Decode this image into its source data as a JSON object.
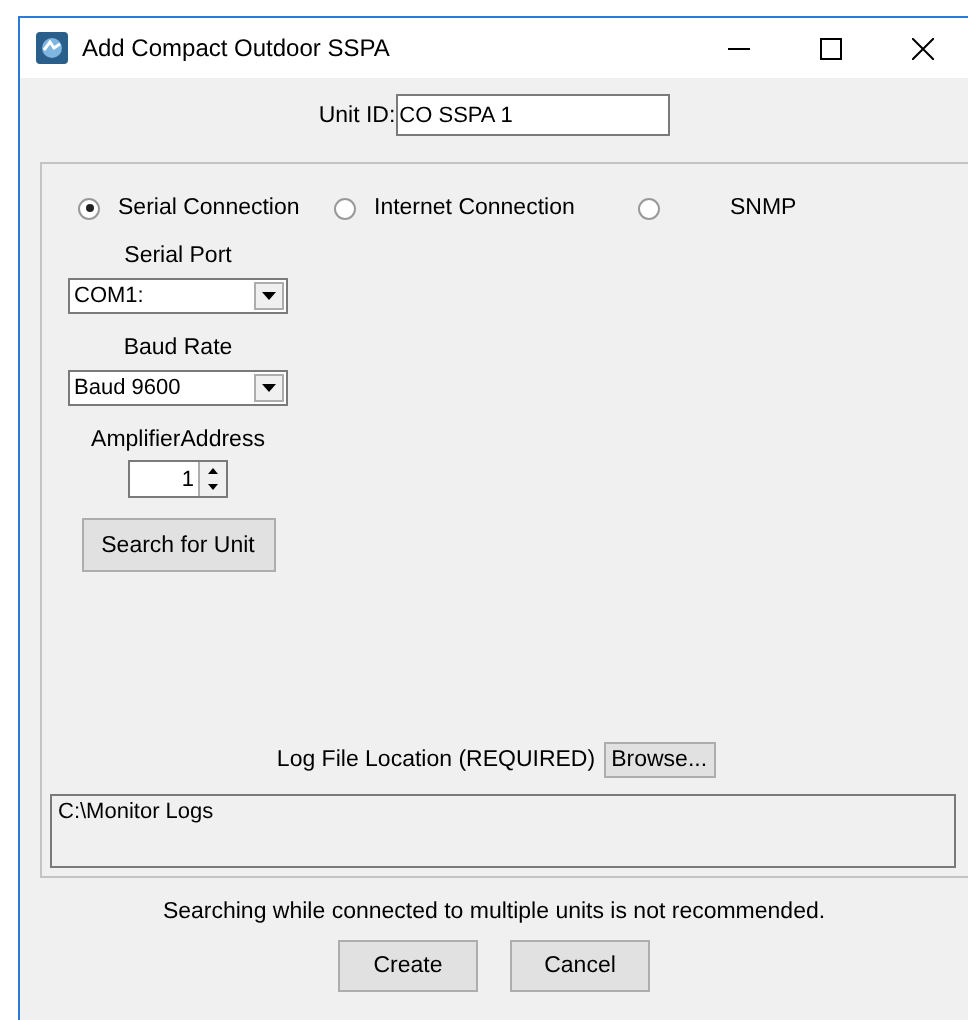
{
  "window": {
    "title": "Add Compact Outdoor SSPA"
  },
  "unit_id": {
    "label": "Unit ID:",
    "value": "CO SSPA 1"
  },
  "connection_options": [
    {
      "label": "Serial Connection",
      "selected": true
    },
    {
      "label": "Internet Connection",
      "selected": false
    },
    {
      "label": "SNMP",
      "selected": false
    }
  ],
  "serial_port": {
    "label": "Serial Port",
    "value": "COM1:"
  },
  "baud_rate": {
    "label": "Baud Rate",
    "value": "Baud 9600"
  },
  "amplifier_address": {
    "label": "AmplifierAddress",
    "value": "1"
  },
  "search_button": "Search for Unit",
  "log_file": {
    "label": "Log File Location (REQUIRED)",
    "browse_button": "Browse...",
    "path": "C:\\Monitor Logs"
  },
  "warning": "Searching while connected to multiple units is not recommended.",
  "buttons": [
    "Create",
    "Cancel"
  ]
}
